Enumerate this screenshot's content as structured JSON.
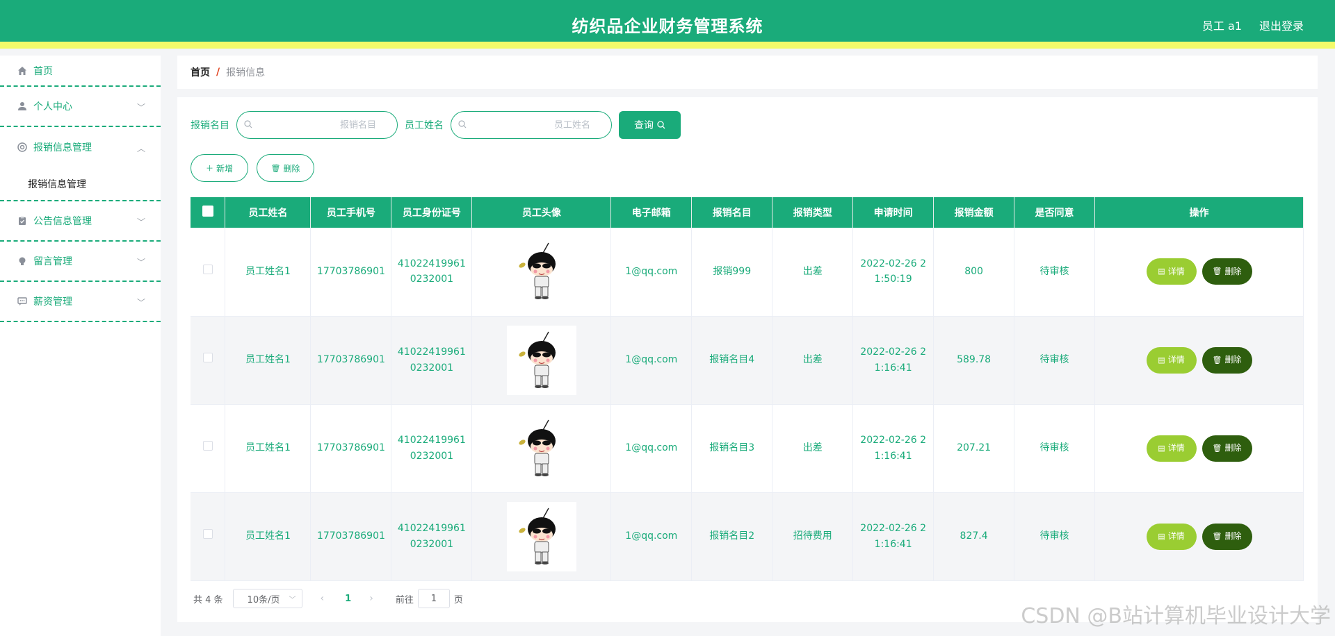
{
  "header": {
    "title": "纺织品企业财务管理系统",
    "user": "员工 a1",
    "logout": "退出登录"
  },
  "sidebar": {
    "items": [
      {
        "label": "首页",
        "icon": "home-icon"
      },
      {
        "label": "个人中心",
        "icon": "user-icon"
      },
      {
        "label": "报销信息管理",
        "icon": "lifebuoy-icon"
      },
      {
        "label": "公告信息管理",
        "icon": "clipboard-icon"
      },
      {
        "label": "留言管理",
        "icon": "bulb-icon"
      },
      {
        "label": "薪资管理",
        "icon": "chat-icon"
      }
    ],
    "submenu": "报销信息管理"
  },
  "breadcrumb": {
    "home": "首页",
    "sep": "/",
    "current": "报销信息"
  },
  "search": {
    "label1": "报销名目",
    "placeholder1": "报销名目",
    "label2": "员工姓名",
    "placeholder2": "员工姓名",
    "query": "查询"
  },
  "actions": {
    "add": "新增",
    "delete": "删除"
  },
  "table": {
    "headers": [
      "员工姓名",
      "员工手机号",
      "员工身份证号",
      "员工头像",
      "电子邮箱",
      "报销名目",
      "报销类型",
      "申请时间",
      "报销金额",
      "是否同意",
      "操作"
    ],
    "rows": [
      {
        "name": "员工姓名1",
        "phone": "17703786901",
        "id1": "41022419961",
        "id2": "0232001",
        "email": "1@qq.com",
        "item": "报销999",
        "type": "出差",
        "time1": "2022-02-26 2",
        "time2": "1:50:19",
        "amount": "800",
        "status": "待审核"
      },
      {
        "name": "员工姓名1",
        "phone": "17703786901",
        "id1": "41022419961",
        "id2": "0232001",
        "email": "1@qq.com",
        "item": "报销名目4",
        "type": "出差",
        "time1": "2022-02-26 2",
        "time2": "1:16:41",
        "amount": "589.78",
        "status": "待审核"
      },
      {
        "name": "员工姓名1",
        "phone": "17703786901",
        "id1": "41022419961",
        "id2": "0232001",
        "email": "1@qq.com",
        "item": "报销名目3",
        "type": "出差",
        "time1": "2022-02-26 2",
        "time2": "1:16:41",
        "amount": "207.21",
        "status": "待审核"
      },
      {
        "name": "员工姓名1",
        "phone": "17703786901",
        "id1": "41022419961",
        "id2": "0232001",
        "email": "1@qq.com",
        "item": "报销名目2",
        "type": "招待费用",
        "time1": "2022-02-26 2",
        "time2": "1:16:41",
        "amount": "827.4",
        "status": "待审核"
      }
    ],
    "detail": "详情",
    "del": "删除"
  },
  "pager": {
    "total": "共 4 条",
    "size": "10条/页",
    "page": "1",
    "goto": "前往",
    "goto_value": "1",
    "unit": "页"
  },
  "watermark": "CSDN @B站计算机毕业设计大学",
  "colors": {
    "primary": "#1aab7a",
    "accent": "#f4fb6a",
    "detail": "#9acd32",
    "delete": "#2e5e0e"
  }
}
